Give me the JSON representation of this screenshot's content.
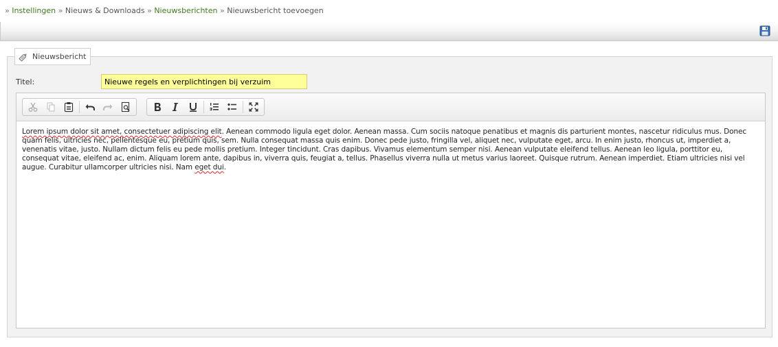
{
  "breadcrumb": {
    "separator": "»",
    "items": [
      {
        "label": "Instellingen",
        "link": true
      },
      {
        "label": "Nieuws & Downloads",
        "link": false
      },
      {
        "label": "Nieuwsberichten",
        "link": true
      },
      {
        "label": "Nieuwsbericht toevoegen",
        "link": false
      }
    ]
  },
  "topbar": {
    "save_icon": "floppy-disk-icon",
    "accent": "#3a6fb5"
  },
  "panel": {
    "legend": "Nieuwsbericht",
    "legend_icon": "tag-icon"
  },
  "form": {
    "title_label": "Titel:",
    "title_value": "Nieuwe regels en verplichtingen bij verzuim",
    "title_bg": "#ffff99"
  },
  "editor": {
    "toolbar": {
      "group1": [
        "cut-icon",
        "copy-icon",
        "paste-icon",
        "undo-icon",
        "redo-icon",
        "preview-icon"
      ],
      "group2": [
        "bold-icon",
        "italic-icon",
        "underline-icon",
        "numbered-list-icon",
        "bulleted-list-icon",
        "maximize-icon"
      ]
    },
    "content": {
      "spell1": "Lorem ipsum dolor sit amet, consectetuer adipiscing elit",
      "body": ". Aenean commodo ligula eget dolor. Aenean massa. Cum sociis natoque penatibus et magnis dis parturient montes, nascetur ridiculus mus. Donec quam felis, ultricies nec, pellentesque eu, pretium quis, sem. Nulla consequat massa quis enim. Donec pede justo, fringilla vel, aliquet nec, vulputate eget, arcu. In enim justo, rhoncus ut, imperdiet a, venenatis vitae, justo. Nullam dictum felis eu pede mollis pretium. Integer tincidunt. Cras dapibus. Vivamus elementum semper nisi. Aenean vulputate eleifend tellus. Aenean leo ligula, porttitor eu, consequat vitae, eleifend ac, enim. Aliquam lorem ante, dapibus in, viverra quis, feugiat a, tellus. Phasellus viverra nulla ut metus varius laoreet. Quisque rutrum. Aenean imperdiet. Etiam ultricies nisi vel augue. Curabitur ullamcorper ultricies nisi. Nam ",
      "spell2": "eget dui",
      "end": "."
    }
  }
}
